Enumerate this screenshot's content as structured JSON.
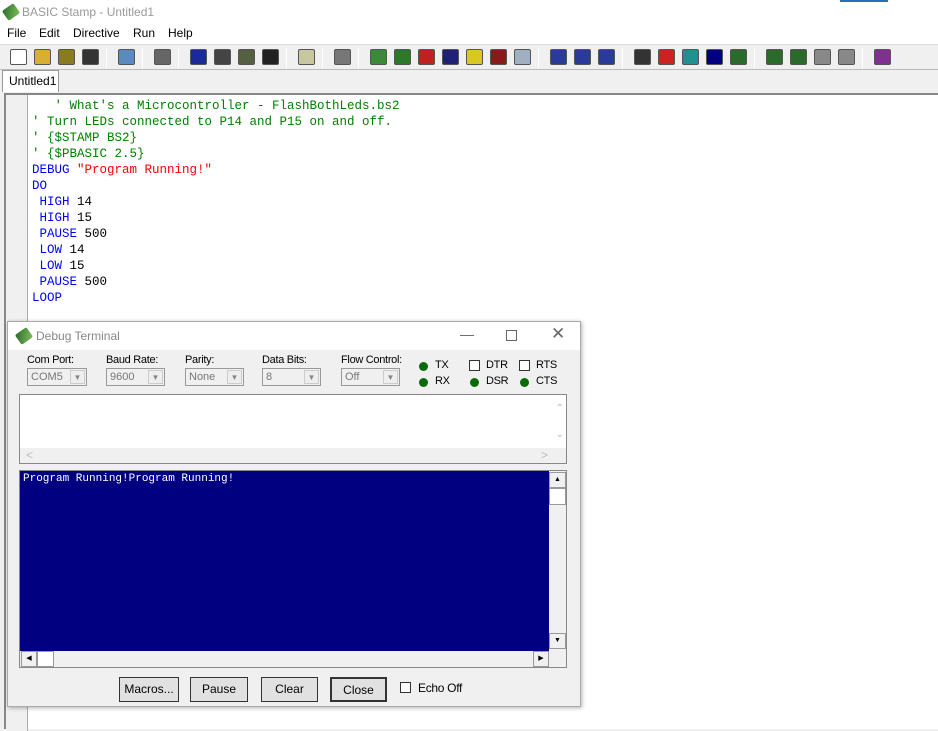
{
  "app": {
    "title": "BASIC Stamp - Untitled1"
  },
  "menu": [
    "File",
    "Edit",
    "Directive",
    "Run",
    "Help"
  ],
  "toolbar": {
    "groups": [
      [
        {
          "name": "new-file-icon",
          "color": "#ffffff"
        },
        {
          "name": "open-folder-icon",
          "color": "#d8b030"
        },
        {
          "name": "open-from-icon",
          "color": "#8a7a20"
        },
        {
          "name": "save-icon",
          "color": "#333333"
        }
      ],
      [
        {
          "name": "find-icon",
          "color": "#5a8ac0"
        }
      ],
      [
        {
          "name": "print-icon",
          "color": "#666666"
        }
      ],
      [
        {
          "name": "cut-icon",
          "color": "#1a2a9a"
        },
        {
          "name": "copy-icon",
          "color": "#444444"
        },
        {
          "name": "paste-icon",
          "color": "#556040"
        },
        {
          "name": "binoculars-icon",
          "color": "#222222"
        }
      ],
      [
        {
          "name": "memory-map-icon",
          "color": "#c8c8a0"
        }
      ],
      [
        {
          "name": "preferences-icon",
          "color": "#777777"
        }
      ],
      [
        {
          "name": "stamp-bs1-icon",
          "color": "#3a8a3a"
        },
        {
          "name": "stamp-bs2-icon",
          "color": "#2a7a2a"
        },
        {
          "name": "stamp-bs2e-icon",
          "color": "#c02020"
        },
        {
          "name": "stamp-bs2sx-icon",
          "color": "#20207a"
        },
        {
          "name": "stamp-bs2p-icon",
          "color": "#d8c820"
        },
        {
          "name": "stamp-bs2pe-icon",
          "color": "#8a1a1a"
        },
        {
          "name": "stamp-bs2px-icon",
          "color": "#a0b0c0"
        }
      ],
      [
        {
          "name": "pbasic-1-0-icon",
          "color": "#2a3a9a"
        },
        {
          "name": "pbasic-2-0-icon",
          "color": "#2a3a9a"
        },
        {
          "name": "pbasic-2-5-icon",
          "color": "#2a3a9a"
        }
      ],
      [
        {
          "name": "identify-icon",
          "color": "#333333"
        },
        {
          "name": "check-syntax-icon",
          "color": "#cc2222"
        },
        {
          "name": "memory-icon",
          "color": "#209090"
        },
        {
          "name": "run-icon",
          "color": "#000080"
        },
        {
          "name": "debug-icon",
          "color": "#2a6a2a"
        }
      ],
      [
        {
          "name": "debug-terminal-1-icon",
          "color": "#2a6a2a"
        },
        {
          "name": "debug-terminal-2-icon",
          "color": "#2a6a2a"
        },
        {
          "name": "debug-terminal-3-icon",
          "color": "#888888"
        },
        {
          "name": "debug-terminal-4-icon",
          "color": "#888888"
        }
      ],
      [
        {
          "name": "help-book-icon",
          "color": "#803090"
        }
      ]
    ]
  },
  "tab": "Untitled1",
  "code": [
    [
      [
        "c",
        "   ' What's a Microcontroller - FlashBothLeds.bs2"
      ]
    ],
    [
      [
        "c",
        "' Turn LEDs connected to P14 and P15 on and off."
      ]
    ],
    [
      [
        "c",
        "' {$STAMP BS2}"
      ]
    ],
    [
      [
        "c",
        "' {$PBASIC 2.5}"
      ]
    ],
    [
      [
        "k",
        "DEBUG "
      ],
      [
        "s",
        "\"Program Running!\""
      ]
    ],
    [
      [
        "k",
        "DO"
      ]
    ],
    [
      [
        "k",
        " HIGH "
      ],
      [
        "n",
        "14"
      ]
    ],
    [
      [
        "k",
        " HIGH "
      ],
      [
        "n",
        "15"
      ]
    ],
    [
      [
        "k",
        " PAUSE "
      ],
      [
        "n",
        "500"
      ]
    ],
    [
      [
        "k",
        " LOW "
      ],
      [
        "n",
        "14"
      ]
    ],
    [
      [
        "k",
        " LOW "
      ],
      [
        "n",
        "15"
      ]
    ],
    [
      [
        "k",
        " PAUSE "
      ],
      [
        "n",
        "500"
      ]
    ],
    [
      [
        "k",
        "LOOP"
      ]
    ]
  ],
  "debug": {
    "title": "Debug Terminal",
    "com_port": {
      "label": "Com Port:",
      "value": "COM5"
    },
    "baud_rate": {
      "label": "Baud Rate:",
      "value": "9600"
    },
    "parity": {
      "label": "Parity:",
      "value": "None"
    },
    "data_bits": {
      "label": "Data Bits:",
      "value": "8"
    },
    "flow_control": {
      "label": "Flow Control:",
      "value": "Off"
    },
    "signals": {
      "tx": "TX",
      "rx": "RX",
      "dtr": "DTR",
      "rts": "RTS",
      "dsr": "DSR",
      "cts": "CTS"
    },
    "dtr_checked": false,
    "rts_checked": false,
    "led_color": "#0a6a0a",
    "transmit_text": "",
    "receive_text": "Program Running!Program Running!",
    "buttons": {
      "macros": "Macros...",
      "pause": "Pause",
      "clear": "Clear",
      "close": "Close"
    },
    "echo_off": {
      "label": "Echo Off",
      "checked": false
    }
  }
}
